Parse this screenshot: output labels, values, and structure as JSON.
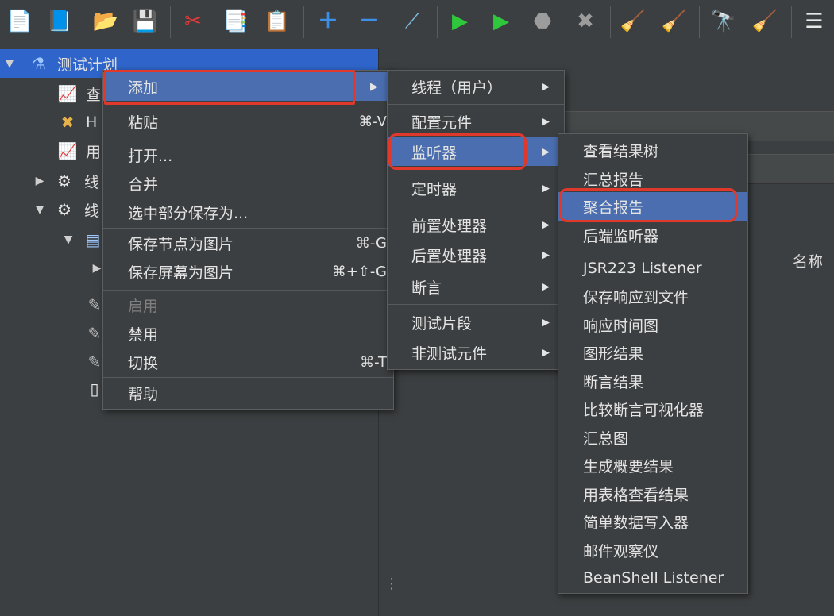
{
  "toolbar": {
    "icons": [
      {
        "name": "new-icon",
        "glyph": "📄"
      },
      {
        "name": "templates-icon",
        "glyph": "📘"
      },
      {
        "name": "open-icon",
        "glyph": "📂"
      },
      {
        "name": "save-icon",
        "glyph": "💾"
      },
      {
        "name": "cut-icon",
        "glyph": "✂"
      },
      {
        "name": "copy-icon",
        "glyph": "📑"
      },
      {
        "name": "paste-icon",
        "glyph": "📋"
      },
      {
        "name": "expand-icon",
        "glyph": "＋"
      },
      {
        "name": "collapse-icon",
        "glyph": "－"
      },
      {
        "name": "toggle-icon",
        "glyph": "⟋"
      },
      {
        "name": "start-icon",
        "glyph": "▶"
      },
      {
        "name": "start-no-pause-icon",
        "glyph": "▶"
      },
      {
        "name": "stop-icon",
        "glyph": "⬣"
      },
      {
        "name": "shutdown-icon",
        "glyph": "✖"
      },
      {
        "name": "clear-icon",
        "glyph": "🧹"
      },
      {
        "name": "clear-all-icon",
        "glyph": "🧹"
      },
      {
        "name": "search-icon",
        "glyph": "🔭"
      },
      {
        "name": "reset-search-icon",
        "glyph": "🧹"
      },
      {
        "name": "function-helper-icon",
        "glyph": "☰"
      }
    ]
  },
  "tree": {
    "root_label": "测试计划",
    "children": [
      {
        "label": "查",
        "icon": "graph-icon",
        "glyph": "📈"
      },
      {
        "label": "H",
        "icon": "tools-icon",
        "glyph": "✖"
      },
      {
        "label": "用",
        "icon": "graph-icon",
        "glyph": "📈"
      },
      {
        "label": "线",
        "icon": "gear-icon",
        "glyph": "⚙"
      },
      {
        "label": "线",
        "icon": "gear-icon",
        "glyph": "⚙"
      }
    ]
  },
  "right_panel": {
    "name_column": "名称"
  },
  "context_menu": {
    "items": [
      {
        "label": "添加",
        "shortcut": "",
        "submenu": true,
        "selected": true
      },
      {
        "label": "粘贴",
        "shortcut": "⌘-V"
      },
      {
        "label": "打开..."
      },
      {
        "label": "合并"
      },
      {
        "label": "选中部分保存为..."
      },
      {
        "label": "保存节点为图片",
        "shortcut": "⌘-G"
      },
      {
        "label": "保存屏幕为图片",
        "shortcut": "⌘+⇧-G"
      },
      {
        "label": "启用",
        "disabled": true
      },
      {
        "label": "禁用"
      },
      {
        "label": "切换",
        "shortcut": "⌘-T"
      },
      {
        "label": "帮助"
      }
    ]
  },
  "add_menu": {
    "items": [
      {
        "label": "线程（用户）",
        "submenu": true
      },
      {
        "label": "配置元件",
        "submenu": true
      },
      {
        "label": "监听器",
        "submenu": true,
        "selected": true
      },
      {
        "label": "定时器",
        "submenu": true
      },
      {
        "label": "前置处理器",
        "submenu": true
      },
      {
        "label": "后置处理器",
        "submenu": true
      },
      {
        "label": "断言",
        "submenu": true
      },
      {
        "label": "测试片段",
        "submenu": true
      },
      {
        "label": "非测试元件",
        "submenu": true
      }
    ]
  },
  "listener_menu": {
    "items": [
      {
        "label": "查看结果树"
      },
      {
        "label": "汇总报告"
      },
      {
        "label": "聚合报告",
        "selected": true
      },
      {
        "label": "后端监听器"
      },
      {
        "label": "JSR223 Listener"
      },
      {
        "label": "保存响应到文件"
      },
      {
        "label": "响应时间图"
      },
      {
        "label": "图形结果"
      },
      {
        "label": "断言结果"
      },
      {
        "label": "比较断言可视化器"
      },
      {
        "label": "汇总图"
      },
      {
        "label": "生成概要结果"
      },
      {
        "label": "用表格查看结果"
      },
      {
        "label": "简单数据写入器"
      },
      {
        "label": "邮件观察仪"
      },
      {
        "label": "BeanShell Listener"
      }
    ]
  },
  "colors": {
    "highlight": "#e0392b",
    "selection": "#4a6eaf",
    "tree_selection": "#2f65ca"
  }
}
